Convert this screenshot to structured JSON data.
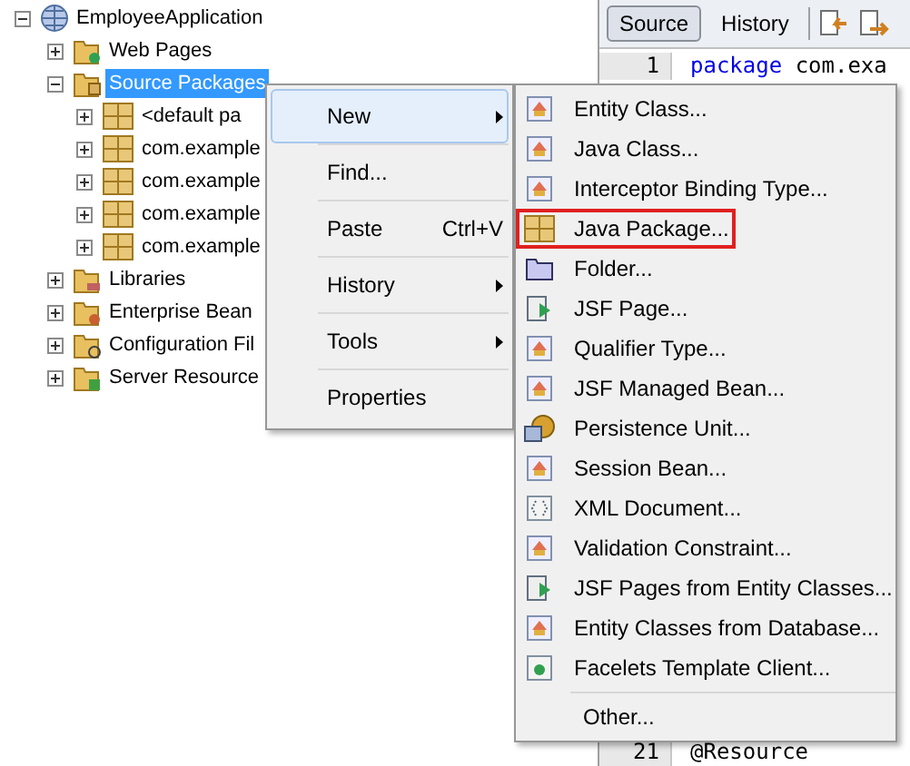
{
  "tree": [
    {
      "label": "EmployeeApplication",
      "kind": "project",
      "expanded": true,
      "selected": false,
      "children": [
        {
          "label": "Web Pages",
          "kind": "web",
          "expanded": false,
          "selected": false
        },
        {
          "label": "Source Packages",
          "kind": "sources",
          "expanded": true,
          "selected": true,
          "children": [
            {
              "label": "<default pa",
              "kind": "package",
              "expanded": false,
              "selected": false
            },
            {
              "label": "com.example",
              "kind": "package",
              "expanded": false,
              "selected": false
            },
            {
              "label": "com.example",
              "kind": "package",
              "expanded": false,
              "selected": false
            },
            {
              "label": "com.example",
              "kind": "package",
              "expanded": false,
              "selected": false
            },
            {
              "label": "com.example",
              "kind": "package",
              "expanded": false,
              "selected": false
            }
          ]
        },
        {
          "label": "Libraries",
          "kind": "libraries",
          "expanded": false,
          "selected": false
        },
        {
          "label": "Enterprise Bean",
          "kind": "beans",
          "expanded": false,
          "selected": false
        },
        {
          "label": "Configuration Fil",
          "kind": "config",
          "expanded": false,
          "selected": false
        },
        {
          "label": "Server Resource",
          "kind": "resources",
          "expanded": false,
          "selected": false
        }
      ]
    }
  ],
  "editor": {
    "tabs": [
      {
        "label": "Source",
        "selected": true
      },
      {
        "label": "History",
        "selected": false
      }
    ],
    "lines": [
      {
        "number": "1",
        "keyword": "package",
        "text": "com.exa"
      },
      {
        "number": "21",
        "text": "@Resource"
      }
    ]
  },
  "context_menu": [
    {
      "label": "New",
      "submenu": true,
      "selected": true
    },
    {
      "label": "Find...",
      "submenu": false,
      "selected": false
    },
    {
      "label": "Paste",
      "shortcut": "Ctrl+V",
      "submenu": false,
      "selected": false
    },
    {
      "label": "History",
      "submenu": true,
      "selected": false
    },
    {
      "label": "Tools",
      "submenu": true,
      "selected": false
    },
    {
      "label": "Properties",
      "submenu": false,
      "selected": false
    }
  ],
  "submenu": [
    {
      "label": "Entity Class...",
      "kind": "class",
      "highlighted": false
    },
    {
      "label": "Java Class...",
      "kind": "class",
      "highlighted": false
    },
    {
      "label": "Interceptor Binding Type...",
      "kind": "class",
      "highlighted": false
    },
    {
      "label": "Java Package...",
      "kind": "package",
      "highlighted": true
    },
    {
      "label": "Folder...",
      "kind": "folder",
      "highlighted": false
    },
    {
      "label": "JSF Page...",
      "kind": "page",
      "highlighted": false
    },
    {
      "label": "Qualifier Type...",
      "kind": "class",
      "highlighted": false
    },
    {
      "label": "JSF Managed Bean...",
      "kind": "class",
      "highlighted": false
    },
    {
      "label": "Persistence Unit...",
      "kind": "persistence",
      "highlighted": false
    },
    {
      "label": "Session Bean...",
      "kind": "class",
      "highlighted": false
    },
    {
      "label": "XML Document...",
      "kind": "xml",
      "highlighted": false
    },
    {
      "label": "Validation Constraint...",
      "kind": "class",
      "highlighted": false
    },
    {
      "label": "JSF Pages from Entity Classes...",
      "kind": "page",
      "highlighted": false
    },
    {
      "label": "Entity Classes from Database...",
      "kind": "class",
      "highlighted": false
    },
    {
      "label": "Facelets Template Client...",
      "kind": "template",
      "highlighted": false
    }
  ],
  "submenu_footer": {
    "label": "Other..."
  }
}
